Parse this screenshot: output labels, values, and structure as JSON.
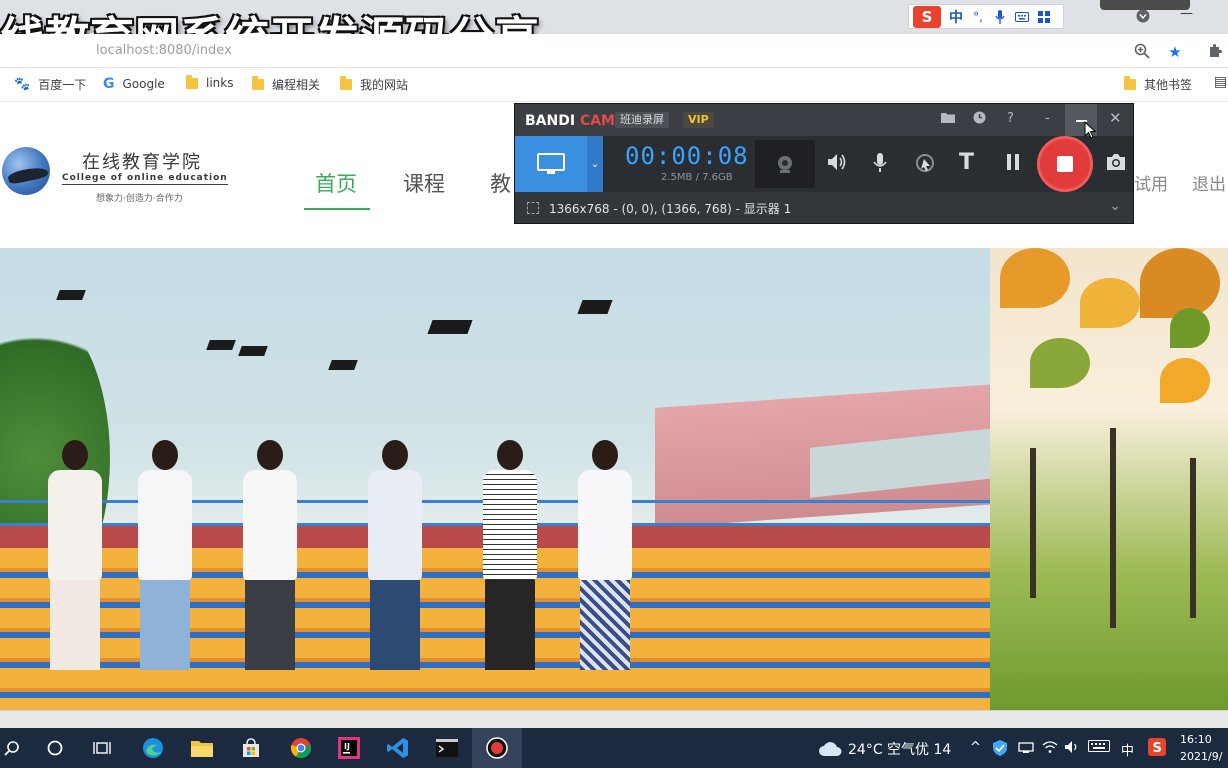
{
  "video_title": "线教育网系统开发源码分享",
  "browser": {
    "url_ghost": "localhost:8080/index",
    "bookmarks": [
      {
        "label": "百度一下",
        "icon": "baidu-paw-icon"
      },
      {
        "label": "Google",
        "icon": "google-g-icon"
      },
      {
        "label": "links",
        "icon": "folder-icon"
      },
      {
        "label": "编程相关",
        "icon": "folder-icon"
      },
      {
        "label": "我的网站",
        "icon": "folder-icon"
      }
    ],
    "other_bookmarks": "其他书签"
  },
  "ime": {
    "logo": "S",
    "lang": "中"
  },
  "site": {
    "logo_name": "在线教育学院",
    "logo_en": "College of online education",
    "logo_slogan": "想象力·创造力·合作力",
    "nav": [
      "首页",
      "课程",
      "教"
    ],
    "active_nav": "首页",
    "header_links": [
      "试用",
      "退出"
    ]
  },
  "bandicam": {
    "brand": "BANDICAM",
    "subtitle": "班迪录屏",
    "vip": "VIP",
    "timer": "00:00:08",
    "file_size": "2.5MB / 7.6GB",
    "capture_info": "1366x768 - (0, 0), (1366, 768) - 显示器 1"
  },
  "taskbar": {
    "weather": "24°C  空气优 14",
    "ime": "中",
    "time": "16:10",
    "date": "2021/9/"
  },
  "colors": {
    "accent_green": "#3aaa5c",
    "bandicam_blue": "#3a8fe0",
    "record_red": "#e23b3b",
    "taskbar": "#1b2a3f"
  }
}
